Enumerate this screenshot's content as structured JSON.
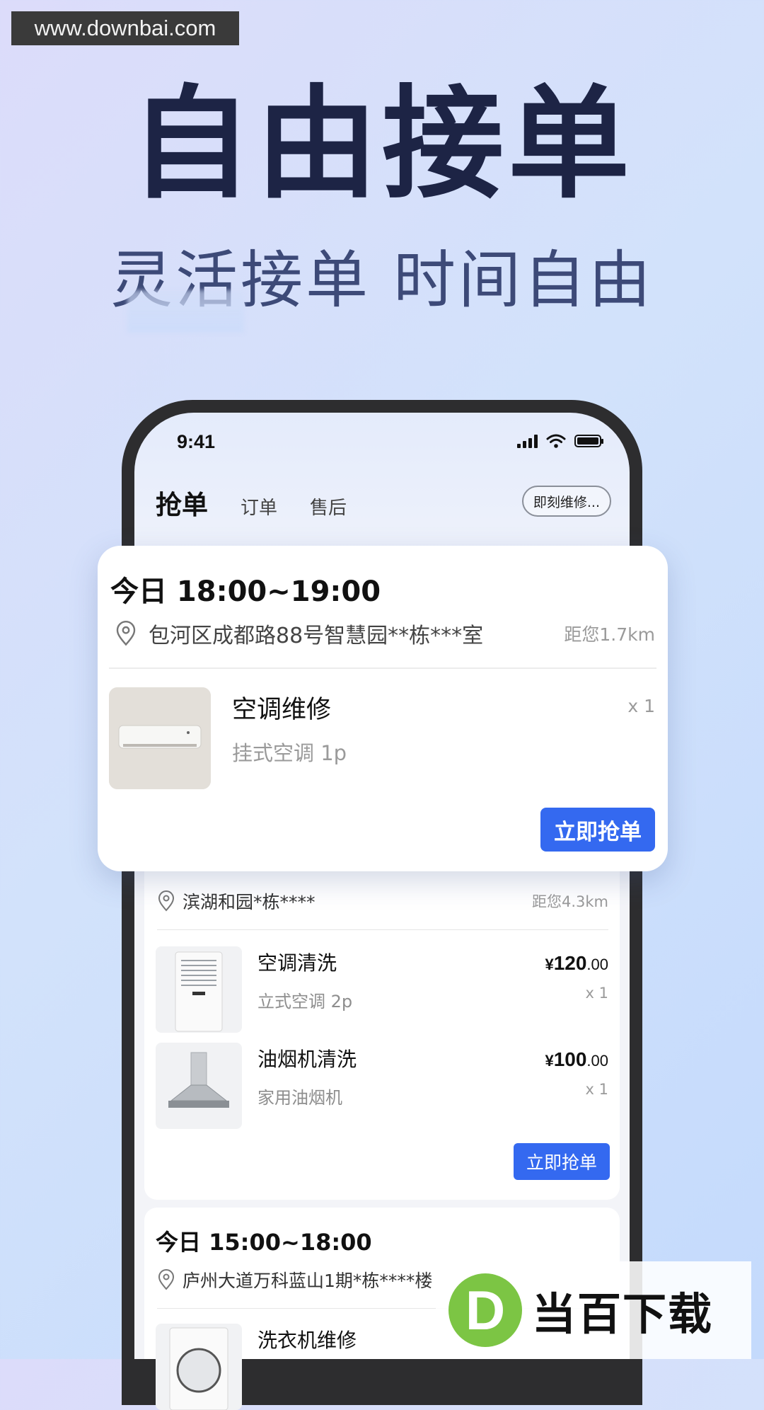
{
  "watermark": {
    "site": "www.downbai.com",
    "brand_mark": "D",
    "brand_name": "当百下载"
  },
  "hero": {
    "title": "自由接单",
    "subtitle": "灵活接单 时间自由"
  },
  "status_bar": {
    "time": "9:41"
  },
  "tabs": {
    "active": "抢单",
    "items": [
      "订单",
      "售后"
    ],
    "filter": "即刻维修..."
  },
  "featured_order": {
    "time": "今日 18:00~19:00",
    "address": "包河区成都路88号智慧园**栋***室",
    "distance": "距您1.7km",
    "item": {
      "name": "空调维修",
      "spec": "挂式空调 1p",
      "qty": "x 1"
    },
    "button": "立即抢单"
  },
  "order_2": {
    "address": "滨湖和园*栋****",
    "distance": "距您4.3km",
    "items": [
      {
        "name": "空调清洗",
        "spec": "立式空调 2p",
        "currency": "¥",
        "price_int": "120",
        "price_dec": ".00",
        "qty": "x 1"
      },
      {
        "name": "油烟机清洗",
        "spec": "家用油烟机",
        "currency": "¥",
        "price_int": "100",
        "price_dec": ".00",
        "qty": "x 1"
      }
    ],
    "button": "立即抢单"
  },
  "order_3": {
    "time": "今日 15:00~18:00",
    "address": "庐州大道万科蓝山1期*栋****楼",
    "items": [
      {
        "name": "洗衣机维修"
      }
    ]
  },
  "colors": {
    "accent": "#3469f0",
    "headline": "#1d2445",
    "brand_green": "#7cc544"
  }
}
